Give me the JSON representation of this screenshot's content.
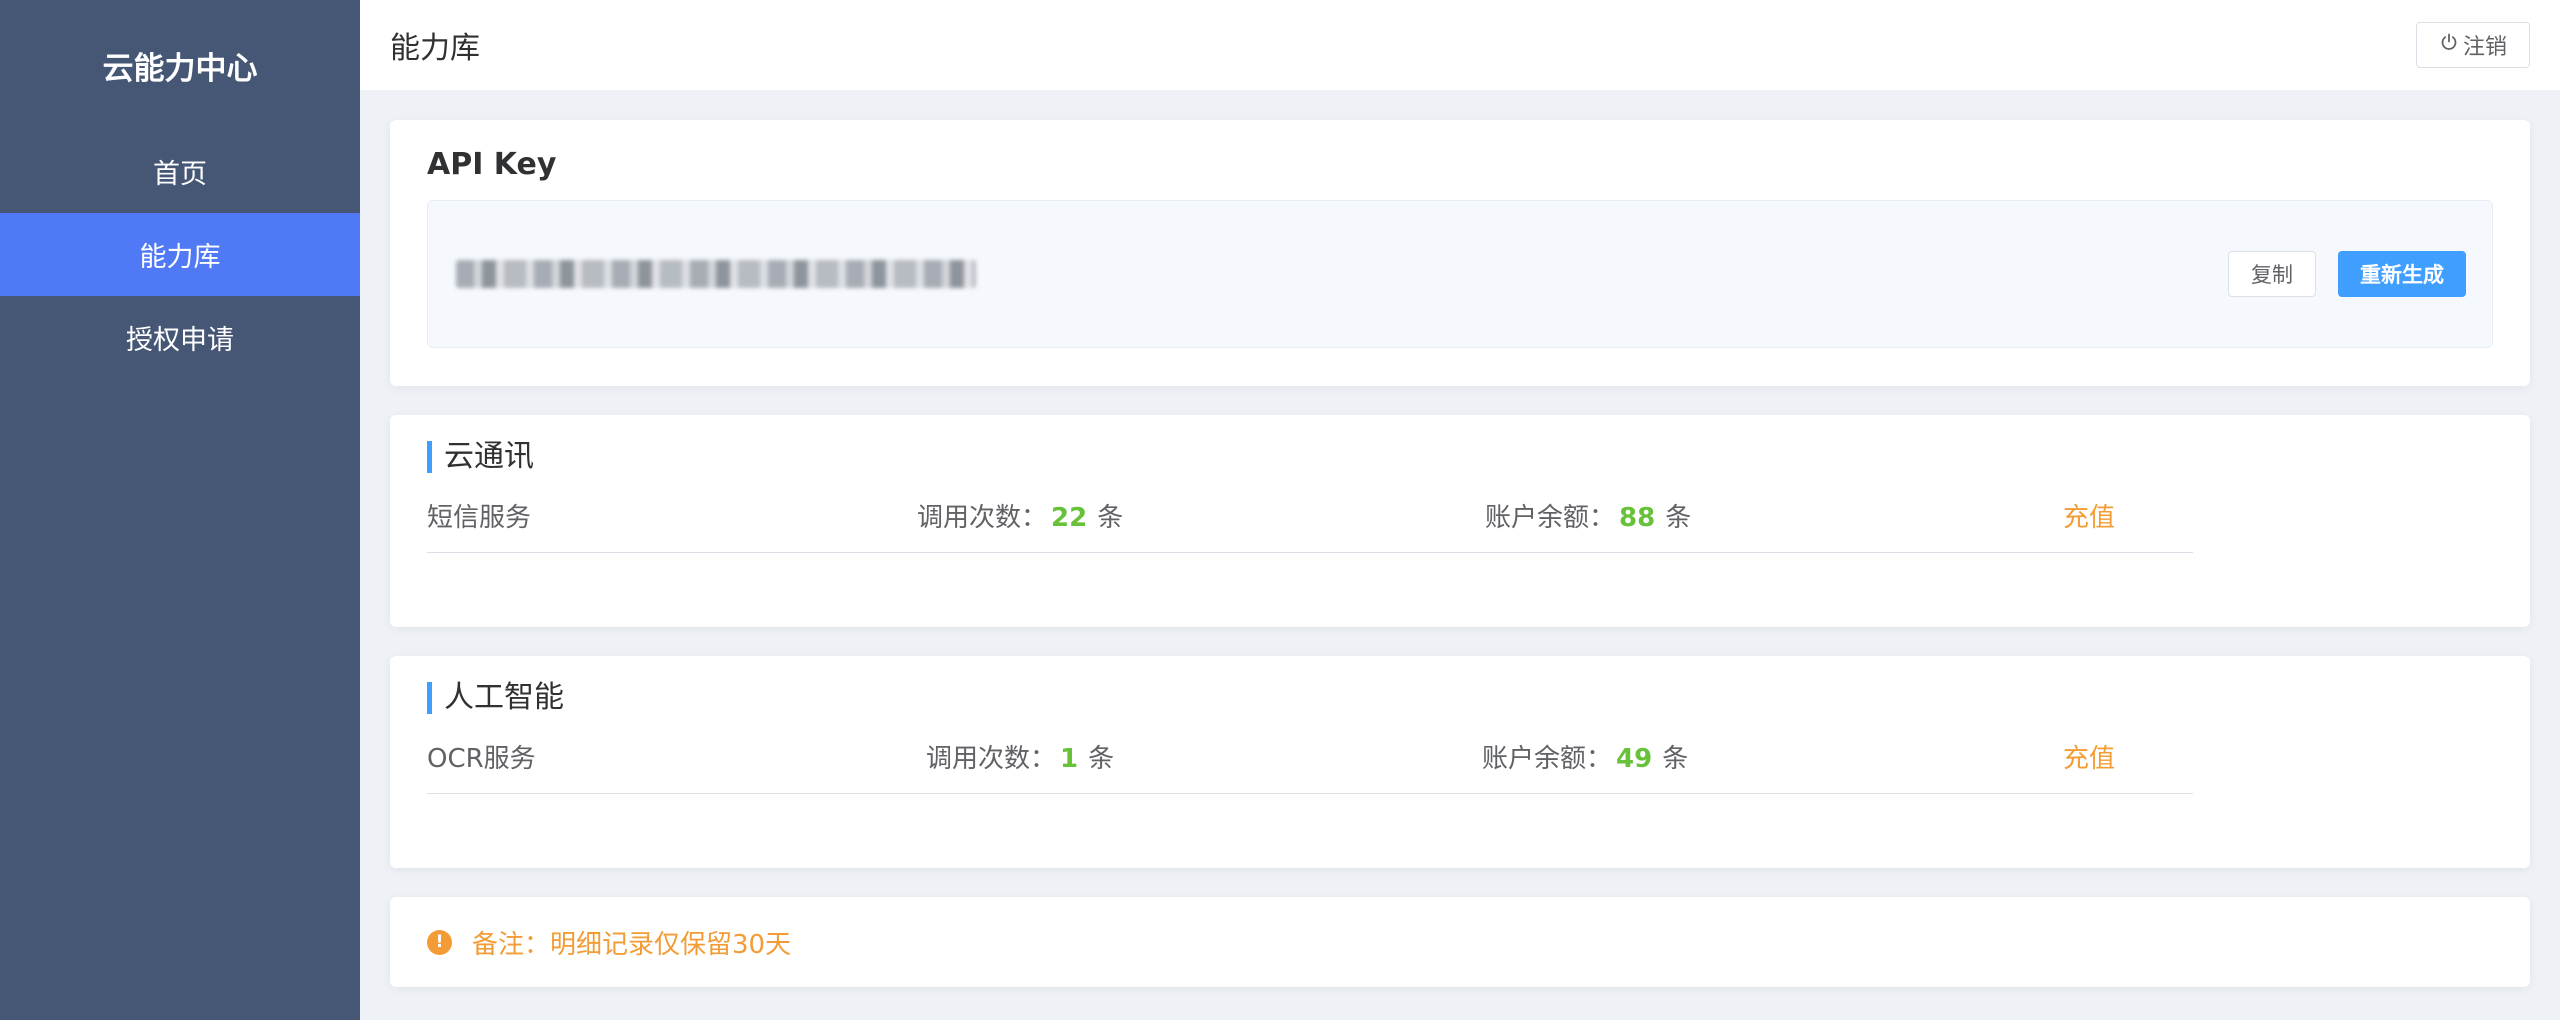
{
  "sidebar": {
    "brand": "云能力中心",
    "items": [
      {
        "label": "首页"
      },
      {
        "label": "能力库"
      },
      {
        "label": "授权申请"
      }
    ]
  },
  "header": {
    "title": "能力库",
    "logout_label": "注销",
    "logout_icon": "power-icon"
  },
  "api_key": {
    "title": "API Key",
    "value_masked": "(blurred)",
    "copy_label": "复制",
    "regenerate_label": "重新生成"
  },
  "sections": [
    {
      "title": "云通讯",
      "service": {
        "name": "短信服务",
        "calls_label": "调用次数：",
        "calls_value": "22",
        "balance_label": "账户余额：",
        "balance_value": "88",
        "unit": "条",
        "recharge_label": "充值"
      }
    },
    {
      "title": "人工智能",
      "service": {
        "name": "OCR服务",
        "calls_label": "调用次数：",
        "calls_value": "1",
        "balance_label": "账户余额：",
        "balance_value": "49",
        "unit": "条",
        "recharge_label": "充值"
      }
    }
  ],
  "note": {
    "text": "备注：明细记录仅保留30天",
    "icon": "warning-icon"
  },
  "colors": {
    "sidebar_bg": "#465775",
    "active_item": "#5079f6",
    "primary": "#409eff",
    "success_number": "#67c23a",
    "warning": "#f39c35"
  }
}
